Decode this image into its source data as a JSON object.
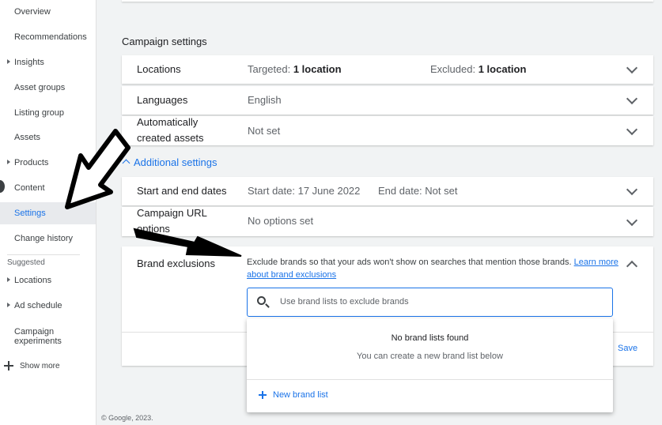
{
  "sidebar": {
    "items": [
      {
        "label": "Overview"
      },
      {
        "label": "Recommendations"
      },
      {
        "label": "Insights"
      },
      {
        "label": "Asset groups"
      },
      {
        "label": "Listing group"
      },
      {
        "label": "Assets"
      },
      {
        "label": "Products"
      },
      {
        "label": "Content"
      },
      {
        "label": "Settings"
      },
      {
        "label": "Change history"
      }
    ],
    "suggested_label": "Suggested",
    "suggested_items": [
      {
        "label": "Locations"
      },
      {
        "label": "Ad schedule"
      },
      {
        "label": "Campaign experiments"
      }
    ],
    "show_more": "Show more"
  },
  "main": {
    "section_title": "Campaign settings",
    "locations": {
      "label": "Locations",
      "targeted_prefix": "Targeted:",
      "targeted_value": "1 location",
      "excluded_prefix": "Excluded:",
      "excluded_value": "1 location"
    },
    "languages": {
      "label": "Languages",
      "value": "English"
    },
    "auto_assets": {
      "label_line1": "Automatically",
      "label_line2": "created assets",
      "value": "Not set"
    },
    "additional_settings": "Additional settings",
    "dates": {
      "label": "Start and end dates",
      "start": "Start date: 17 June 2022",
      "end": "End date: Not set"
    },
    "campaign_url": {
      "label_line1": "Campaign URL",
      "label_line2": "options",
      "value": "No options set"
    },
    "brand_exclusions": {
      "label": "Brand exclusions",
      "description": "Exclude brands so that your ads won't show on searches that mention those brands.",
      "learn_more": "Learn more about brand exclusions",
      "search_placeholder": "Use brand lists to exclude brands",
      "save": "Save"
    },
    "dropdown": {
      "title": "No brand lists found",
      "subtitle": "You can create a new brand list below",
      "new_list": "New brand list"
    }
  },
  "footer": "© Google, 2023."
}
